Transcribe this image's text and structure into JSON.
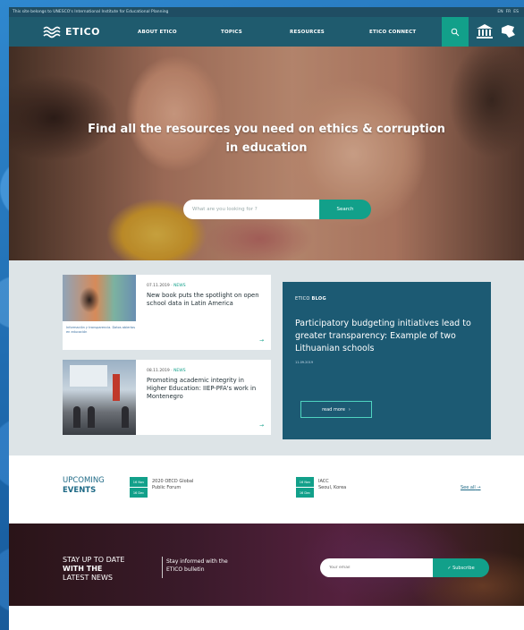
{
  "top_strip": {
    "text": "This site belongs to UNESCO's International Institute for Educational Planning",
    "languages": [
      "EN",
      "FR",
      "ES"
    ]
  },
  "nav": {
    "logo_text": "ETICO",
    "menu": [
      "ABOUT ETICO",
      "TOPICS",
      "RESOURCES",
      "ETICO CONNECT"
    ],
    "icons": [
      "search-icon",
      "institution-icon",
      "unesco-icon"
    ]
  },
  "hero": {
    "title_line1": "Find all the resources you need on ethics & corruption",
    "title_line2": "in education",
    "search_placeholder": "What are you looking for ?",
    "search_button": "Search"
  },
  "news": [
    {
      "date": "07.11.2019",
      "tag": "NEWS",
      "title": "New book puts the spotlight on open school data in Latin America",
      "image_caption": "Información y transparencia. Datos abiertos en educación",
      "arrow": "→"
    },
    {
      "date": "08.11.2019",
      "tag": "NEWS",
      "title": "Promoting academic integrity in Higher Education: IIEP-PFA's work in Montenegro",
      "arrow": "→"
    }
  ],
  "blog": {
    "label_prefix": "ETICO",
    "label_bold": "BLOG",
    "title": "Participatory budgeting initiatives lead to greater transparency: Example of two Lithuanian schools",
    "date": "11.09.2019",
    "read_more": "read more",
    "read_more_arrow": "›"
  },
  "events": {
    "title_line1": "UPCOMING",
    "title_line2": "EVENTS",
    "items": [
      {
        "date_start": "16 Nov",
        "date_end": "16 Dec",
        "line1": "2020 OECD Global",
        "line2": "Public Forum"
      },
      {
        "date_start": "16 Nov",
        "date_end": "16 Dec",
        "line1": "IACC",
        "line2": "Seoul, Korea"
      }
    ],
    "see_all": "See all",
    "see_all_arrow": "→"
  },
  "newsletter": {
    "title_line1": "STAY UP TO DATE",
    "title_line2": "WITH THE",
    "title_line3": "LATEST NEWS",
    "text_line1": "Stay informed with the",
    "text_line2": "ETICO bulletin",
    "email_placeholder": "Your email",
    "subscribe": "✓ Subscribe"
  },
  "colors": {
    "teal": "#12a08a",
    "nav": "#1f5b6e",
    "blog": "#1c5a73",
    "page_bg": "#1e6fb0"
  }
}
